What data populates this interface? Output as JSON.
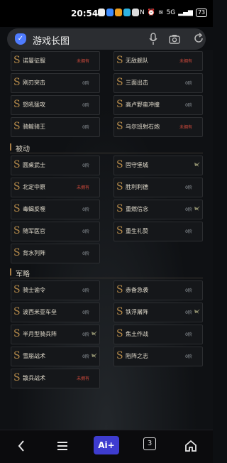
{
  "status_bar": {
    "time": "20:54",
    "signal_text": "5G",
    "battery": "73"
  },
  "url_bar": {
    "title": "游戏长图"
  },
  "sections": {
    "passive_title": "被动",
    "tactic_title": "军略"
  },
  "top_cards": [
    {
      "name": "诺曼征服",
      "status": "未拥有",
      "status_red": true
    },
    {
      "name": "无敌舰队",
      "status": "未拥有",
      "status_red": true
    },
    {
      "name": "刚刃突击",
      "status": "0阶",
      "status_red": false
    },
    {
      "name": "三面出击",
      "status": "0阶",
      "status_red": false
    },
    {
      "name": "怒吼猛攻",
      "status": "0阶",
      "status_red": false
    },
    {
      "name": "高卢野蛮冲撞",
      "status": "0阶",
      "status_red": false
    },
    {
      "name": "骑鲸骑王",
      "status": "0阶",
      "status_red": false
    },
    {
      "name": "乌尔班射石炮",
      "status": "未拥有",
      "status_red": true
    }
  ],
  "passive_cards": [
    {
      "name": "圆桌武士",
      "status": "0阶",
      "status_red": false
    },
    {
      "name": "固守堡城",
      "status": "",
      "status_red": false,
      "bird": true
    },
    {
      "name": "北定中原",
      "status": "未拥有",
      "status_red": true
    },
    {
      "name": "胜利利德",
      "status": "0阶",
      "status_red": false
    },
    {
      "name": "毒蝎反噬",
      "status": "0阶",
      "status_red": false
    },
    {
      "name": "重燃信念",
      "status": "0阶",
      "status_red": false,
      "bird": true
    },
    {
      "name": "随军医官",
      "status": "0阶",
      "status_red": false
    },
    {
      "name": "重生礼赞",
      "status": "0阶",
      "status_red": false
    },
    {
      "name": "背水列阵",
      "status": "0阶",
      "status_red": false
    }
  ],
  "tactic_cards": [
    {
      "name": "骑士谕令",
      "status": "0阶",
      "status_red": false
    },
    {
      "name": "赤备急袭",
      "status": "0阶",
      "status_red": false
    },
    {
      "name": "波西米亚车垒",
      "status": "0阶",
      "status_red": false
    },
    {
      "name": "铁浮屠阵",
      "status": "0阶",
      "status_red": false,
      "bird": true
    },
    {
      "name": "半月型骑兵阵",
      "status": "0阶",
      "status_red": false,
      "bird": true
    },
    {
      "name": "焦土作战",
      "status": "0阶",
      "status_red": false
    },
    {
      "name": "雪崩战术",
      "status": "0阶",
      "status_red": false,
      "bird": true
    },
    {
      "name": "陷阵之志",
      "status": "0阶",
      "status_red": false
    },
    {
      "name": "散兵战术",
      "status": "未拥有",
      "status_red": true
    }
  ],
  "bottom_nav": {
    "ai_label": "Ai+",
    "tab_count": "3"
  },
  "colors": {
    "accent_gold": "#b58a4a",
    "not_owned_red": "#d24a3c",
    "ai_button": "#3e3ccf"
  }
}
